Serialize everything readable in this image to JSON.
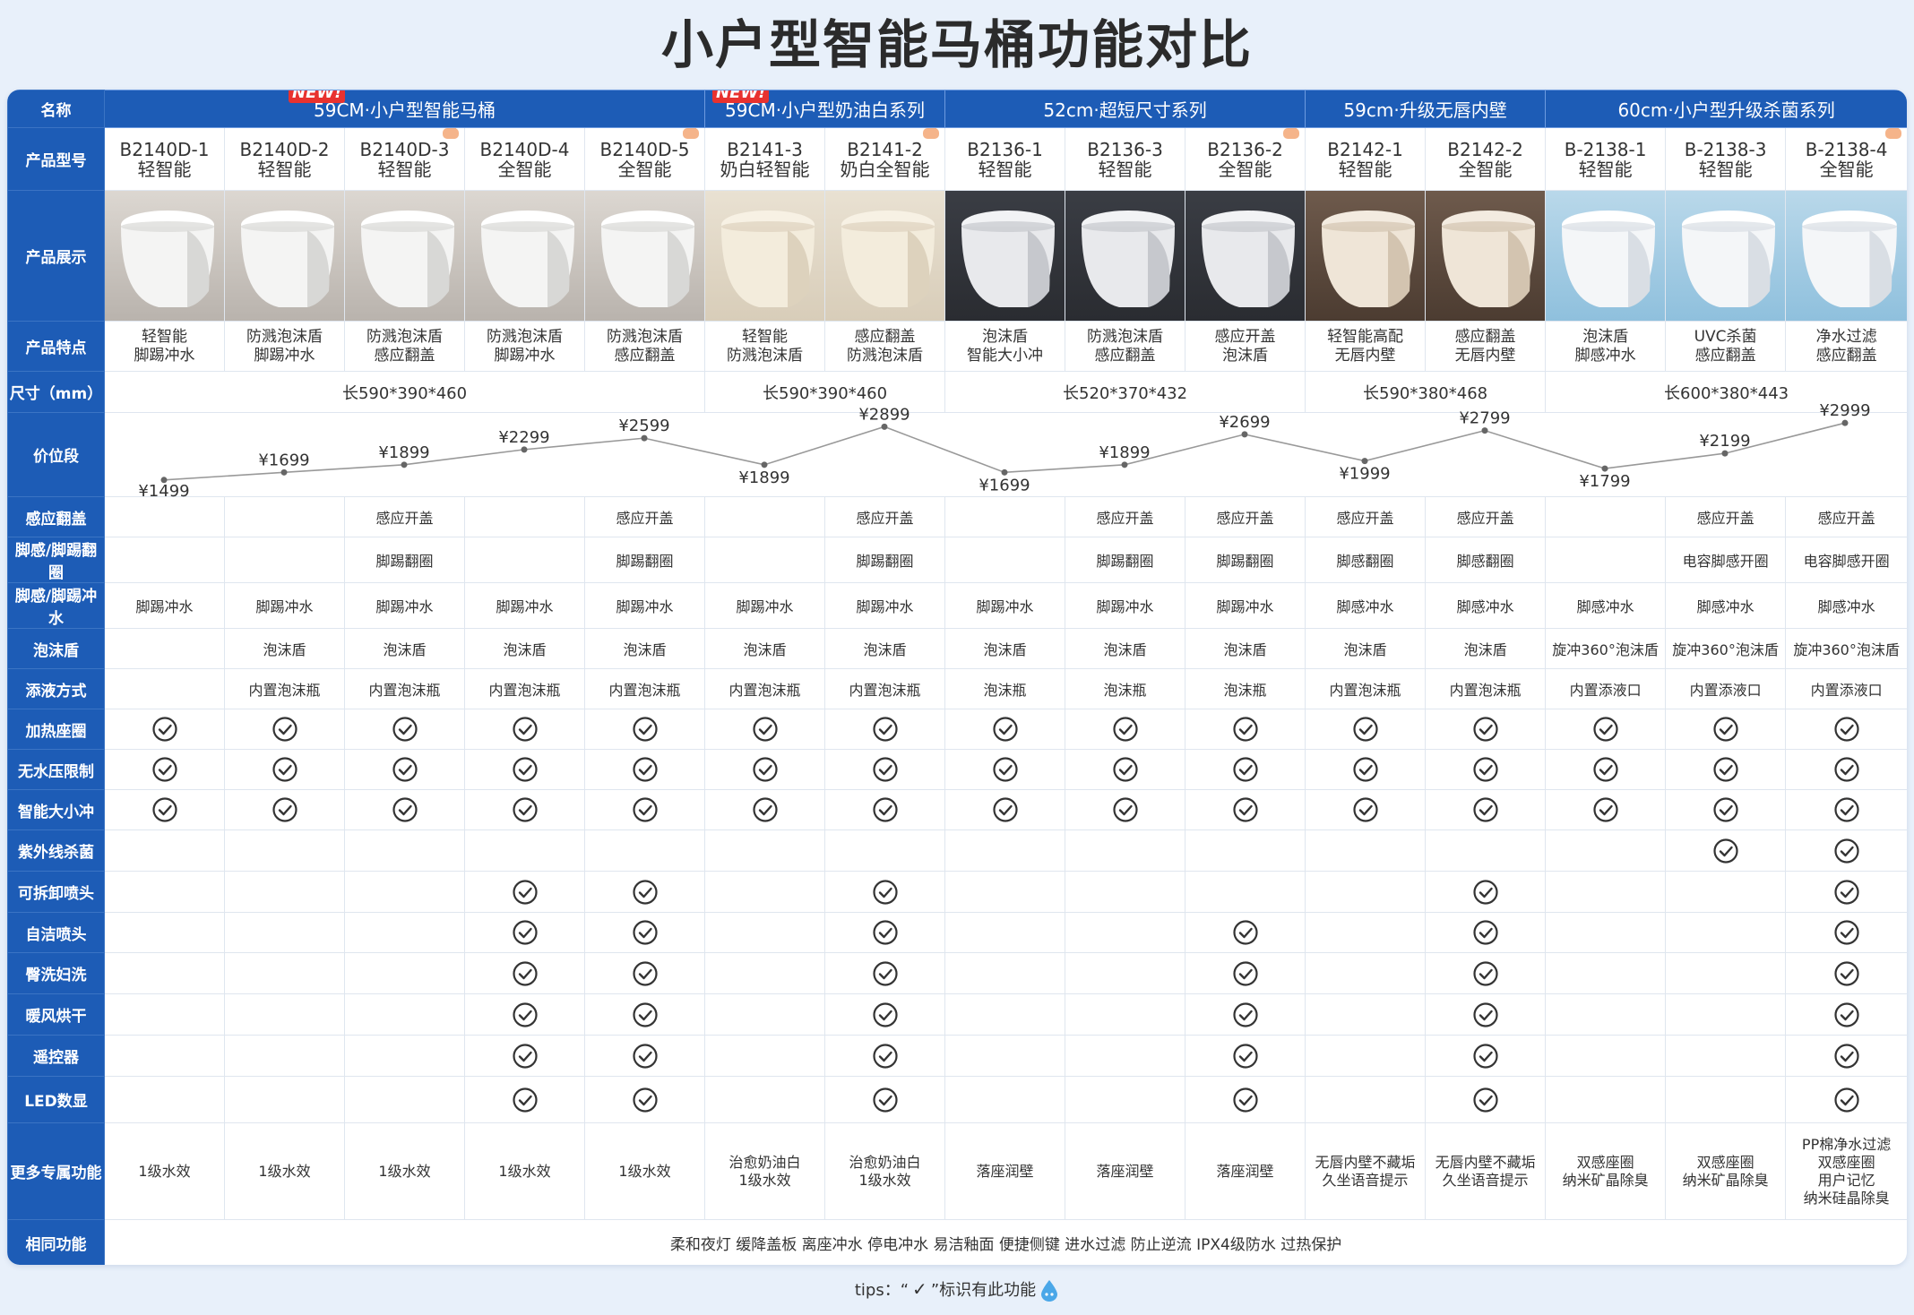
{
  "title": "小户型智能马桶功能对比",
  "colors": {
    "header_blue": "#1d5cb6",
    "new_red": "#e8322f",
    "line_gray": "#888888"
  },
  "labels": {
    "name": "名称",
    "model": "产品型号",
    "display": "产品展示",
    "features": "产品特点",
    "size": "尺寸（mm）",
    "price": "价位段",
    "more": "更多专属功能",
    "common": "相同功能"
  },
  "groups": [
    {
      "name": "59CM·小户型智能马桶",
      "span": 5,
      "new": "NEW!"
    },
    {
      "name": "59CM·小户型奶油白系列",
      "span": 2,
      "new": "NEW!"
    },
    {
      "name": "52cm·超短尺寸系列",
      "span": 3,
      "new": ""
    },
    {
      "name": "59cm·升级无唇内壁",
      "span": 2,
      "new": ""
    },
    {
      "name": "60cm·小户型升级杀菌系列",
      "span": 3,
      "new": ""
    }
  ],
  "products": [
    {
      "model": "B2140D-1",
      "type": "轻智能",
      "f1": "轻智能",
      "f2": "脚踢冲水",
      "price": "¥1499",
      "pv": 1499,
      "more": [
        "1级水效"
      ],
      "finish": "white"
    },
    {
      "model": "B2140D-2",
      "type": "轻智能",
      "f1": "防溅泡沫盾",
      "f2": "脚踢冲水",
      "price": "¥1699",
      "pv": 1699,
      "more": [
        "1级水效"
      ],
      "finish": "white"
    },
    {
      "model": "B2140D-3",
      "type": "轻智能",
      "f1": "防溅泡沫盾",
      "f2": "感应翻盖",
      "price": "¥1899",
      "pv": 1899,
      "more": [
        "1级水效"
      ],
      "finish": "white"
    },
    {
      "model": "B2140D-4",
      "type": "全智能",
      "f1": "防溅泡沫盾",
      "f2": "脚踢冲水",
      "price": "¥2299",
      "pv": 2299,
      "more": [
        "1级水效"
      ],
      "finish": "white"
    },
    {
      "model": "B2140D-5",
      "type": "全智能",
      "f1": "防溅泡沫盾",
      "f2": "感应翻盖",
      "price": "¥2599",
      "pv": 2599,
      "more": [
        "1级水效"
      ],
      "finish": "white"
    },
    {
      "model": "B2141-3",
      "type": "奶白轻智能",
      "f1": "轻智能",
      "f2": "防溅泡沫盾",
      "price": "¥1899",
      "pv": 1899,
      "more": [
        "治愈奶油白",
        "1级水效"
      ],
      "finish": "cream"
    },
    {
      "model": "B2141-2",
      "type": "奶白全智能",
      "f1": "感应翻盖",
      "f2": "防溅泡沫盾",
      "price": "¥2899",
      "pv": 2899,
      "more": [
        "治愈奶油白",
        "1级水效"
      ],
      "finish": "cream"
    },
    {
      "model": "B2136-1",
      "type": "轻智能",
      "f1": "泡沫盾",
      "f2": "智能大小冲",
      "price": "¥1699",
      "pv": 1699,
      "more": [
        "落座润壁"
      ],
      "finish": "dark"
    },
    {
      "model": "B2136-3",
      "type": "轻智能",
      "f1": "防溅泡沫盾",
      "f2": "感应翻盖",
      "price": "¥1899",
      "pv": 1899,
      "more": [
        "落座润壁"
      ],
      "finish": "dark"
    },
    {
      "model": "B2136-2",
      "type": "全智能",
      "f1": "感应开盖",
      "f2": "泡沫盾",
      "price": "¥2699",
      "pv": 2699,
      "more": [
        "落座润壁"
      ],
      "finish": "dark"
    },
    {
      "model": "B2142-1",
      "type": "轻智能",
      "f1": "轻智能高配",
      "f2": "无唇内壁",
      "price": "¥1999",
      "pv": 1999,
      "more": [
        "无唇内壁不藏垢",
        "久坐语音提示"
      ],
      "finish": "brown"
    },
    {
      "model": "B2142-2",
      "type": "全智能",
      "f1": "感应翻盖",
      "f2": "无唇内壁",
      "price": "¥2799",
      "pv": 2799,
      "more": [
        "无唇内壁不藏垢",
        "久坐语音提示"
      ],
      "finish": "brown"
    },
    {
      "model": "B-2138-1",
      "type": "轻智能",
      "f1": "泡沫盾",
      "f2": "脚感冲水",
      "price": "¥1799",
      "pv": 1799,
      "more": [
        "双感座圈",
        "纳米矿晶除臭"
      ],
      "finish": "blue"
    },
    {
      "model": "B-2138-3",
      "type": "轻智能",
      "f1": "UVC杀菌",
      "f2": "感应翻盖",
      "price": "¥2199",
      "pv": 2199,
      "more": [
        "双感座圈",
        "纳米矿晶除臭"
      ],
      "finish": "blue"
    },
    {
      "model": "B-2138-4",
      "type": "全智能",
      "f1": "净水过滤",
      "f2": "感应翻盖",
      "price": "¥2999",
      "pv": 2999,
      "more": [
        "PP棉净水过滤",
        "双感座圈",
        "用户记忆",
        "纳米硅晶除臭"
      ],
      "finish": "blue"
    }
  ],
  "sizes": [
    {
      "text": "长590*390*460",
      "span": 5
    },
    {
      "text": "长590*390*460",
      "span": 2
    },
    {
      "text": "长520*370*432",
      "span": 3
    },
    {
      "text": "长590*380*468",
      "span": 2
    },
    {
      "text": "长600*380*443",
      "span": 3
    }
  ],
  "text_rows": [
    {
      "label": "感应翻盖",
      "cells": [
        "",
        "",
        "感应开盖",
        "",
        "感应开盖",
        "",
        "感应开盖",
        "",
        "感应开盖",
        "感应开盖",
        "感应开盖",
        "感应开盖",
        "",
        "感应开盖",
        "感应开盖"
      ]
    },
    {
      "label": "脚感/脚踢翻圈",
      "cells": [
        "",
        "",
        "脚踢翻圈",
        "",
        "脚踢翻圈",
        "",
        "脚踢翻圈",
        "",
        "脚踢翻圈",
        "脚踢翻圈",
        "脚感翻圈",
        "脚感翻圈",
        "",
        "电容脚感开圈",
        "电容脚感开圈"
      ]
    },
    {
      "label": "脚感/脚踢冲水",
      "cells": [
        "脚踢冲水",
        "脚踢冲水",
        "脚踢冲水",
        "脚踢冲水",
        "脚踢冲水",
        "脚踢冲水",
        "脚踢冲水",
        "脚踢冲水",
        "脚踢冲水",
        "脚踢冲水",
        "脚感冲水",
        "脚感冲水",
        "脚感冲水",
        "脚感冲水",
        "脚感冲水"
      ]
    },
    {
      "label": "泡沫盾",
      "cells": [
        "",
        "泡沫盾",
        "泡沫盾",
        "泡沫盾",
        "泡沫盾",
        "泡沫盾",
        "泡沫盾",
        "泡沫盾",
        "泡沫盾",
        "泡沫盾",
        "泡沫盾",
        "泡沫盾",
        "旋冲360°泡沫盾",
        "旋冲360°泡沫盾",
        "旋冲360°泡沫盾"
      ]
    },
    {
      "label": "添液方式",
      "cells": [
        "",
        "内置泡沫瓶",
        "内置泡沫瓶",
        "内置泡沫瓶",
        "内置泡沫瓶",
        "内置泡沫瓶",
        "内置泡沫瓶",
        "泡沫瓶",
        "泡沫瓶",
        "泡沫瓶",
        "内置泡沫瓶",
        "内置泡沫瓶",
        "内置添液口",
        "内置添液口",
        "内置添液口"
      ]
    }
  ],
  "check_rows": [
    {
      "label": "加热座圈",
      "cells": [
        1,
        1,
        1,
        1,
        1,
        1,
        1,
        1,
        1,
        1,
        1,
        1,
        1,
        1,
        1
      ]
    },
    {
      "label": "无水压限制",
      "cells": [
        1,
        1,
        1,
        1,
        1,
        1,
        1,
        1,
        1,
        1,
        1,
        1,
        1,
        1,
        1
      ]
    },
    {
      "label": "智能大小冲",
      "cells": [
        1,
        1,
        1,
        1,
        1,
        1,
        1,
        1,
        1,
        1,
        1,
        1,
        1,
        1,
        1
      ]
    },
    {
      "label": "紫外线杀菌",
      "cells": [
        0,
        0,
        0,
        0,
        0,
        0,
        0,
        0,
        0,
        0,
        0,
        0,
        0,
        1,
        1
      ]
    },
    {
      "label": "可拆卸喷头",
      "cells": [
        0,
        0,
        0,
        1,
        1,
        0,
        1,
        0,
        0,
        0,
        0,
        1,
        0,
        0,
        1
      ]
    },
    {
      "label": "自洁喷头",
      "cells": [
        0,
        0,
        0,
        1,
        1,
        0,
        1,
        0,
        0,
        1,
        0,
        1,
        0,
        0,
        1
      ]
    },
    {
      "label": "臀洗妇洗",
      "cells": [
        0,
        0,
        0,
        1,
        1,
        0,
        1,
        0,
        0,
        1,
        0,
        1,
        0,
        0,
        1
      ]
    },
    {
      "label": "暖风烘干",
      "cells": [
        0,
        0,
        0,
        1,
        1,
        0,
        1,
        0,
        0,
        1,
        0,
        1,
        0,
        0,
        1
      ]
    },
    {
      "label": "遥控器",
      "cells": [
        0,
        0,
        0,
        1,
        1,
        0,
        1,
        0,
        0,
        1,
        0,
        1,
        0,
        0,
        1
      ]
    },
    {
      "label": "LED数显",
      "cells": [
        0,
        0,
        0,
        1,
        1,
        0,
        1,
        0,
        0,
        1,
        0,
        1,
        0,
        0,
        1
      ]
    }
  ],
  "common": "柔和夜灯 缓降盖板 离座冲水 停电冲水 易洁釉面 便捷侧键 进水过滤 防止逆流 IPX4级防水 过热保护",
  "tips": {
    "prefix": "tips：“",
    "mark": "✓",
    "suffix": "”标识有此功能"
  }
}
